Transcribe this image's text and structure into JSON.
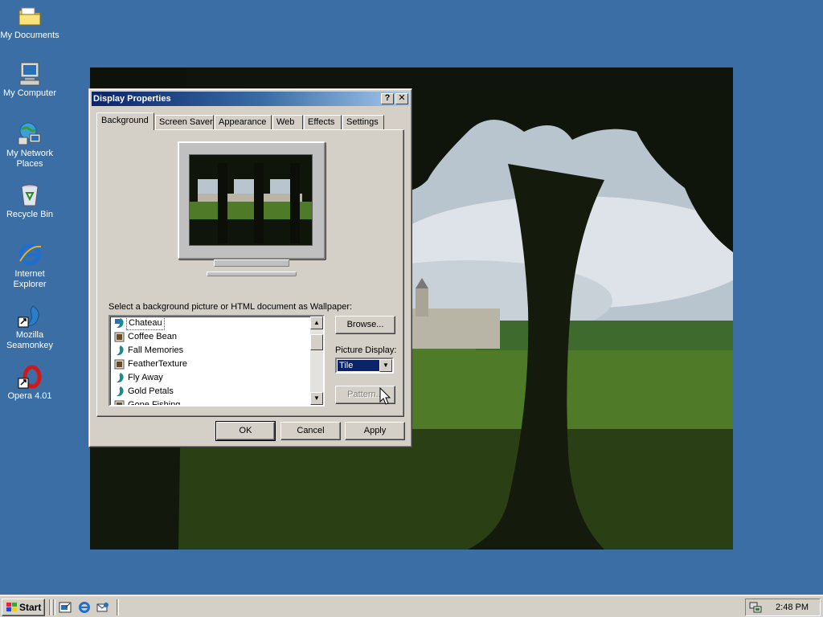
{
  "desktop": {
    "icons": [
      {
        "label": "My Documents",
        "icon": "folder-documents-icon"
      },
      {
        "label": "My Computer",
        "icon": "computer-icon"
      },
      {
        "label": "My Network Places",
        "icon": "network-icon"
      },
      {
        "label": "Recycle Bin",
        "icon": "recycle-bin-icon"
      },
      {
        "label": "Internet Explorer",
        "icon": "internet-explorer-icon"
      },
      {
        "label": "Mozilla Seamonkey",
        "icon": "seamonkey-icon"
      },
      {
        "label": "Opera 4.01",
        "icon": "opera-icon"
      }
    ]
  },
  "window": {
    "title": "Display Properties",
    "help_glyph": "?",
    "close_glyph": "✕",
    "tabs": [
      "Background",
      "Screen Saver",
      "Appearance",
      "Web",
      "Effects",
      "Settings"
    ],
    "active_tab": "Background",
    "prompt": "Select a background picture or HTML document as Wallpaper:",
    "wallpapers": [
      "Chateau",
      "Coffee Bean",
      "Fall Memories",
      "FeatherTexture",
      "Fly Away",
      "Gold Petals",
      "Gone Fishing"
    ],
    "selected_wallpaper": "Chateau",
    "browse_label": "Browse...",
    "picture_display_label": "Picture Display:",
    "picture_display_value": "Tile",
    "pattern_label": "Pattern...",
    "ok_label": "OK",
    "cancel_label": "Cancel",
    "apply_label": "Apply"
  },
  "taskbar": {
    "start_label": "Start",
    "clock": "2:48 PM",
    "quick_launch": [
      "show-desktop-icon",
      "internet-explorer-icon",
      "outlook-express-icon"
    ]
  },
  "colors": {
    "desktop": "#3a6ea5",
    "titlebar_start": "#0a246a",
    "titlebar_end": "#a6caf0",
    "face": "#d4d0c8",
    "selection": "#0a246a"
  }
}
